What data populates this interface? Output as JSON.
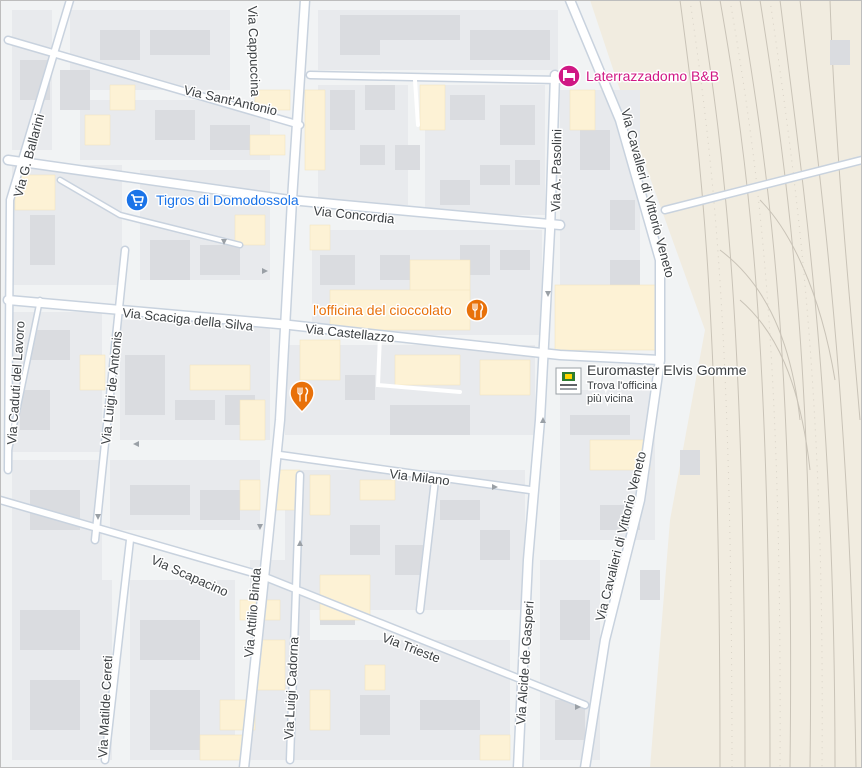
{
  "colors": {
    "background": "#f1f3f4",
    "block": "#e8eaed",
    "building": "#dadce0",
    "building_highlight": "#fdf2d5",
    "road": "#ffffff",
    "road_casing": "#c8d2de",
    "rail_area": "#f1ece0",
    "rail": "#b7b2a8",
    "shopping": "#1a73e8",
    "food": "#e8710a",
    "lodging": "#d01884"
  },
  "streets": {
    "g_ballarini": "Via G. Ballarini",
    "cappuccina": "Via Cappuccina",
    "sant_antonio": "Via Sant'Antonio",
    "concordia": "Via Concordia",
    "scaciga": "Via Scaciga della Silva",
    "castellazzo": "Via Castellazzo",
    "caduti_lavoro": "Via Caduti del Lavoro",
    "luigi_antonis": "Via Luigi de Antonis",
    "milano": "Via Milano",
    "scapacino": "Via Scapacino",
    "attilio_binda": "Via Attilio Binda",
    "luigi_cadorna": "Via Luigi Cadorna",
    "trieste": "Via Trieste",
    "matilde_cereti": "Via Matilde Cereti",
    "alcide_gasperi": "Via Alcide de Gasperi",
    "a_pasolini": "Via A. Pasolini",
    "cavalieri_1": "Via Cavalleri di Vittorio Veneto",
    "cavalieri_2": "Via Cavalieri di Vittorio Veneto"
  },
  "pois": {
    "laterrazzadomo": {
      "name": "Laterrazzadomo B&B",
      "icon": "hotel-bed-icon"
    },
    "tigros": {
      "name": "Tigros di Domodossola",
      "icon": "shopping-cart-icon"
    },
    "officina": {
      "name": "l'officina del cioccolato",
      "icon": "restaurant-icon"
    },
    "restaurant": {
      "icon": "restaurant-icon"
    },
    "euromaster": {
      "name": "Euromaster Elvis Gomme",
      "line1": "Trova l'officina",
      "line2": "più vicina",
      "icon": "euromaster-logo-icon"
    }
  }
}
